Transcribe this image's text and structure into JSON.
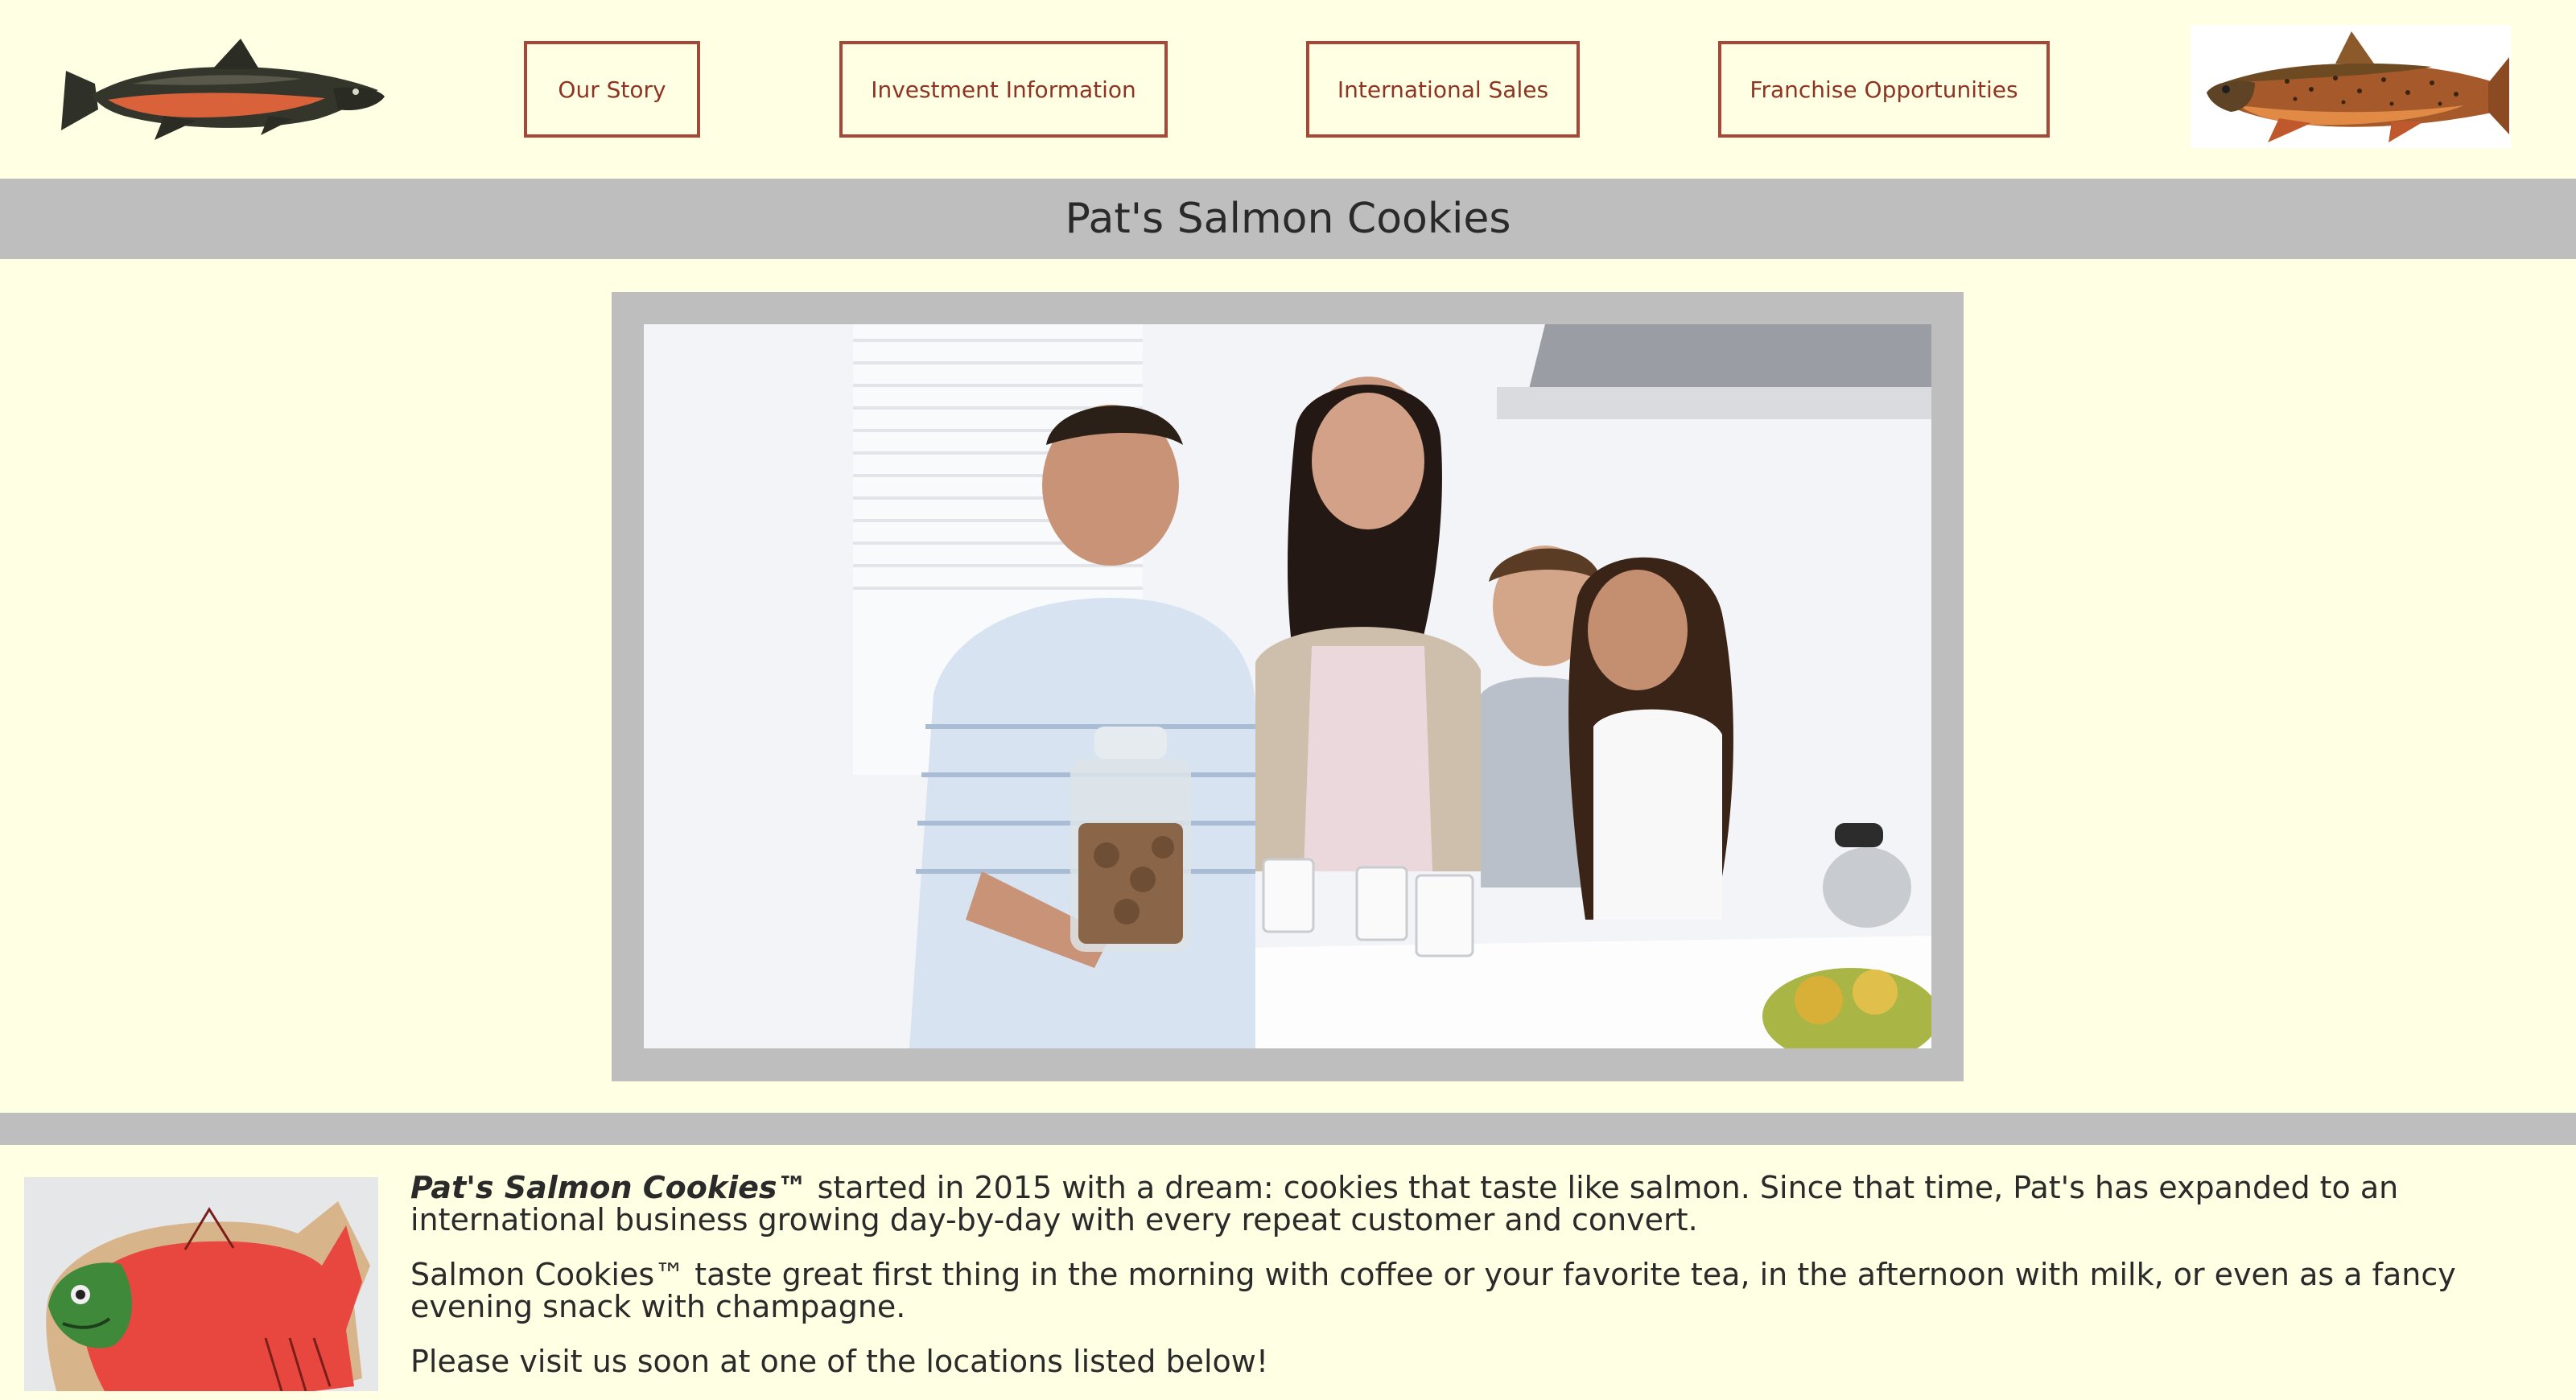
{
  "header": {
    "left_logo_icon": "salmon-illustration",
    "right_logo_icon": "trout-illustration",
    "nav": [
      {
        "label": "Our Story"
      },
      {
        "label": "Investment Information"
      },
      {
        "label": "International Sales"
      },
      {
        "label": "Franchise Opportunities"
      }
    ]
  },
  "title": "Pat's Salmon Cookies",
  "hero": {
    "image": "family-kitchen-photo"
  },
  "content": {
    "cookie_image": "salmon-shaped-cookie",
    "paragraphs": [
      {
        "brand": "Pat's Salmon Cookies™",
        "text": " started in 2015 with a dream: cookies that taste like salmon. Since that time, Pat's has expanded to an international business growing day-by-day with every repeat customer and convert."
      },
      {
        "text": "Salmon Cookies™ taste great first thing in the morning with coffee or your favorite tea, in the afternoon with milk, or even as a fancy evening snack with champagne."
      },
      {
        "text": "Please visit us soon at one of the locations listed below!"
      }
    ]
  },
  "colors": {
    "page_bg": "#FFFFE3",
    "band_gray": "#BEBEBE",
    "nav_border": "#A54838",
    "nav_text": "#8E3424"
  }
}
